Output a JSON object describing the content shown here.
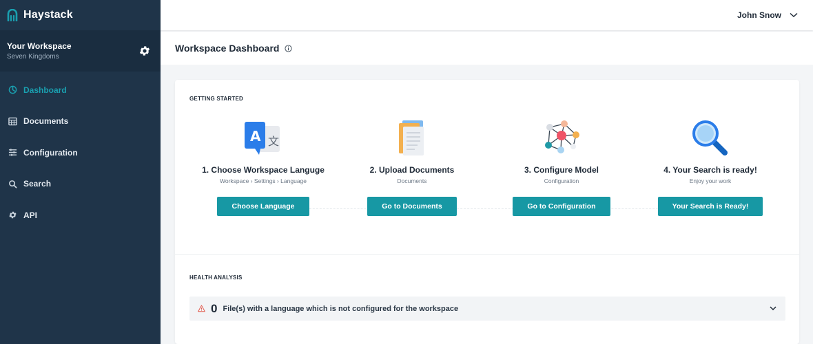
{
  "app": {
    "name": "Haystack"
  },
  "workspace": {
    "title": "Your Workspace",
    "subtitle": "Seven Kingdoms"
  },
  "sidebar": {
    "items": [
      {
        "label": "Dashboard",
        "icon": "dashboard-icon",
        "active": true
      },
      {
        "label": "Documents",
        "icon": "documents-icon",
        "active": false
      },
      {
        "label": "Configuration",
        "icon": "configuration-icon",
        "active": false
      },
      {
        "label": "Search",
        "icon": "search-icon",
        "active": false
      },
      {
        "label": "API",
        "icon": "api-icon",
        "active": false
      }
    ]
  },
  "user": {
    "name": "John Snow"
  },
  "header": {
    "title": "Workspace Dashboard"
  },
  "getting_started": {
    "title": "GETTING STARTED",
    "steps": [
      {
        "title": "1. Choose Workspace Languge",
        "subtitle": "Workspace › Settings › Language",
        "button": "Choose Language",
        "icon": "translate-icon"
      },
      {
        "title": "2. Upload Documents",
        "subtitle": "Documents",
        "button": "Go to Documents",
        "icon": "documents-illustration-icon"
      },
      {
        "title": "3. Configure Model",
        "subtitle": "Configuration",
        "button": "Go to Configuration",
        "icon": "network-model-icon"
      },
      {
        "title": "4. Your Search is ready!",
        "subtitle": "Enjoy your work",
        "button": "Your Search is Ready!",
        "icon": "magnifier-icon"
      }
    ]
  },
  "health": {
    "title": "HEALTH ANALYSIS",
    "count": "0",
    "text": "File(s) with a language which is not configured for the workspace"
  },
  "colors": {
    "sidebar": "#1f3449",
    "accent": "#1798a4",
    "active_nav": "#1aa0b0",
    "warning": "#e25c4f"
  }
}
